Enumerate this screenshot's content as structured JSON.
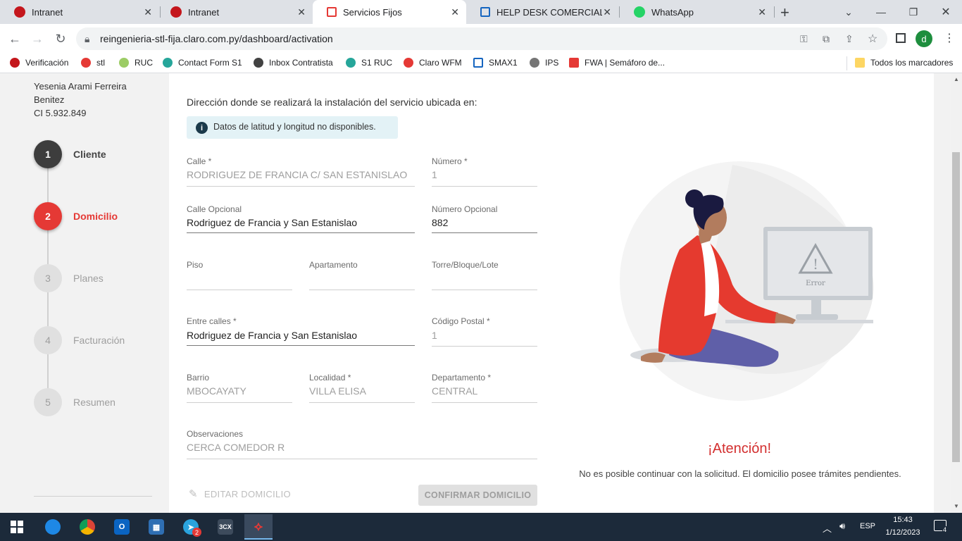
{
  "browser": {
    "tabs": [
      {
        "title": "Intranet",
        "color": "#c4161c"
      },
      {
        "title": "Intranet",
        "color": "#c4161c"
      },
      {
        "title": "Servicios Fijos",
        "color": "#e53935",
        "active": true
      },
      {
        "title": "HELP DESK COMERCIAL - ER",
        "color": "#1565c0"
      },
      {
        "title": "WhatsApp",
        "color": "#25d366"
      }
    ],
    "url": "reingenieria-stl-fija.claro.com.py/dashboard/activation",
    "profile_initial": "d",
    "bookmarks": [
      {
        "label": "Verificación",
        "color": "#c4161c"
      },
      {
        "label": "stl",
        "color": "#e53935"
      },
      {
        "label": "RUC",
        "color": "#9ccc65"
      },
      {
        "label": "Contact Form S1",
        "color": "#26a69a"
      },
      {
        "label": "Inbox Contratista",
        "color": "#424242"
      },
      {
        "label": "S1 RUC",
        "color": "#26a69a"
      },
      {
        "label": "Claro WFM",
        "color": "#e53935"
      },
      {
        "label": "SMAX1",
        "color": "#1565c0"
      },
      {
        "label": "IPS",
        "color": "#757575"
      },
      {
        "label": "FWA | Semáforo de...",
        "color": "#e53935"
      }
    ],
    "all_bookmarks": "Todos los marcadores"
  },
  "sidebar": {
    "person_name_line1": "Yesenia Arami Ferreira",
    "person_name_line2": "Benitez",
    "person_ci": "CI 5.932.849",
    "steps": [
      {
        "number": "1",
        "label": "Cliente",
        "state": "done"
      },
      {
        "number": "2",
        "label": "Domicilio",
        "state": "active"
      },
      {
        "number": "3",
        "label": "Planes",
        "state": "pending"
      },
      {
        "number": "4",
        "label": "Facturación",
        "state": "pending"
      },
      {
        "number": "5",
        "label": "Resumen",
        "state": "pending"
      }
    ]
  },
  "form": {
    "heading": "Dirección donde se realizará la instalación del servicio ubicada en:",
    "info_message": "Datos de latitud y longitud no disponibles.",
    "calle_label": "Calle *",
    "calle_value": "RODRIGUEZ DE FRANCIA C/ SAN ESTANISLAO",
    "numero_label": "Número *",
    "numero_value": "1",
    "calle_opc_label": "Calle Opcional",
    "calle_opc_value": "Rodriguez de Francia y San Estanislao",
    "numero_opc_label": "Número Opcional",
    "numero_opc_value": "882",
    "piso_label": "Piso",
    "apto_label": "Apartamento",
    "torre_label": "Torre/Bloque/Lote",
    "entre_label": "Entre calles *",
    "entre_value": "Rodriguez de Francia y San Estanislao",
    "cp_label": "Código Postal *",
    "cp_value": "1",
    "barrio_label": "Barrio",
    "barrio_value": "MBOCAYATY",
    "localidad_label": "Localidad *",
    "localidad_value": "VILLA ELISA",
    "depto_label": "Departamento *",
    "depto_value": "CENTRAL",
    "obs_label": "Observaciones",
    "obs_value": "CERCA COMEDOR R",
    "edit_button": "EDITAR DOMICILIO",
    "confirm_button": "CONFIRMAR DOMICILIO"
  },
  "alert": {
    "error_label": "Error",
    "title": "¡Atención!",
    "message": "No es posible continuar con la solicitud. El domicilio posee trámites pendientes."
  },
  "taskbar": {
    "lang": "ESP",
    "time": "15:43",
    "date": "1/12/2023",
    "notif_count": "4",
    "badge": "2",
    "cx_label": "3CX"
  }
}
